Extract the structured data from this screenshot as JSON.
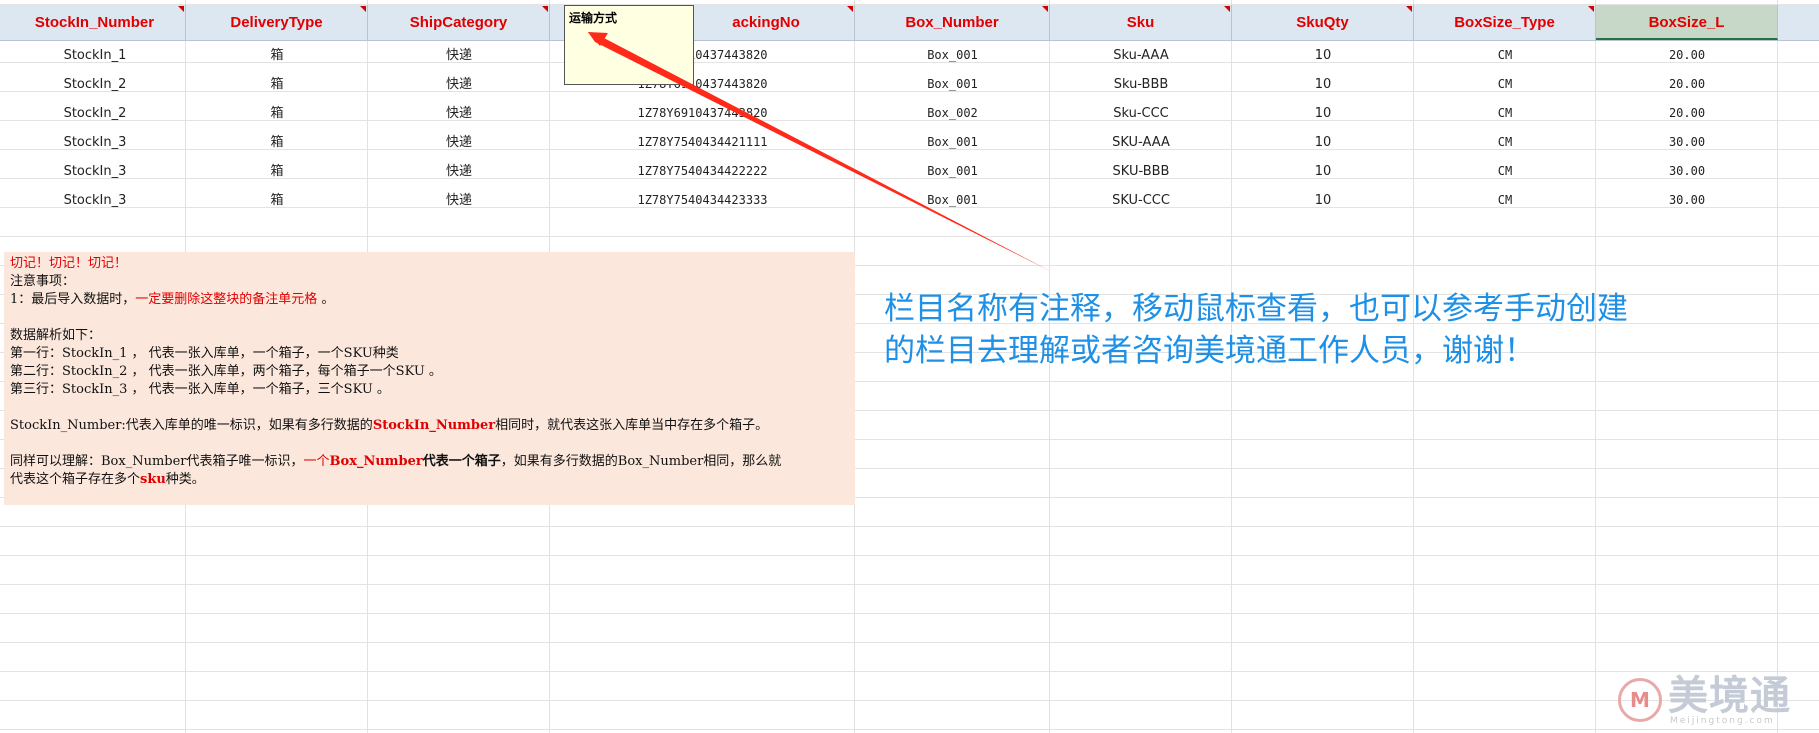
{
  "columns": [
    "StockIn_Number",
    "DeliveryType",
    "ShipCategory",
    "TrackingNo",
    "Box_Number",
    "Sku",
    "SkuQty",
    "BoxSize_Type",
    "BoxSize_L"
  ],
  "column_header_visible": {
    "trackingno": "ackingNo"
  },
  "rows": [
    {
      "stockin": "StockIn_1",
      "delivery": "箱",
      "ship": "快递",
      "tracking": "1Z78Y6910437443820",
      "box": "Box_001",
      "sku": "Sku-AAA",
      "qty": "10",
      "size_type": "CM",
      "size_l": "20.00"
    },
    {
      "stockin": "StockIn_2",
      "delivery": "箱",
      "ship": "快递",
      "tracking": "1Z78Y6910437443820",
      "box": "Box_001",
      "sku": "Sku-BBB",
      "qty": "10",
      "size_type": "CM",
      "size_l": "20.00"
    },
    {
      "stockin": "StockIn_2",
      "delivery": "箱",
      "ship": "快递",
      "tracking": "1Z78Y6910437443820",
      "box": "Box_002",
      "sku": "Sku-CCC",
      "qty": "10",
      "size_type": "CM",
      "size_l": "20.00"
    },
    {
      "stockin": "StockIn_3",
      "delivery": "箱",
      "ship": "快递",
      "tracking": "1Z78Y7540434421111",
      "box": "Box_001",
      "sku": "SKU-AAA",
      "qty": "10",
      "size_type": "CM",
      "size_l": "30.00"
    },
    {
      "stockin": "StockIn_3",
      "delivery": "箱",
      "ship": "快递",
      "tracking": "1Z78Y7540434422222",
      "box": "Box_001",
      "sku": "SKU-BBB",
      "qty": "10",
      "size_type": "CM",
      "size_l": "30.00"
    },
    {
      "stockin": "StockIn_3",
      "delivery": "箱",
      "ship": "快递",
      "tracking": "1Z78Y7540434423333",
      "box": "Box_001",
      "sku": "SKU-CCC",
      "qty": "10",
      "size_type": "CM",
      "size_l": "30.00"
    }
  ],
  "comment": {
    "text": "运输方式"
  },
  "notes": {
    "warning": "切记！切记！切记！",
    "heading": "注意事项：",
    "point1_prefix": "1：最后导入数据时，",
    "point1_red": "一定要删除这整块的备注单元格",
    "point1_suffix": " 。",
    "explain_heading": "数据解析如下：",
    "line1": "第一行：StockIn_1 ， 代表一张入库单，一个箱子，一个SKU种类",
    "line2": "第二行：StockIn_2 ，  代表一张入库单，两个箱子，每个箱子一个SKU  。",
    "line3": "第三行：StockIn_3 ， 代表一张入库单，一个箱子，三个SKU  。",
    "p1_prefix": "StockIn_Number:代表入库单的唯一标识，如果有多行数据的",
    "p1_bold": "StockIn_Number",
    "p1_suffix": "相同时，就代表这张入库单当中存在多个箱子。",
    "p2_prefix": "同样可以理解：Box_Number代表箱子唯一标识，",
    "p2_red": "一个",
    "p2_redbold": "Box_Number",
    "p2_bold": "代表一个箱子",
    "p2_suffix": "，如果有多行数据的Box_Number相同，那么就",
    "p3_prefix": "代表这个箱子存在多个",
    "p3_redbold": "sku",
    "p3_suffix": "种类。"
  },
  "annotation": {
    "line1": "栏目名称有注释，移动鼠标查看，也可以参考手动创建",
    "line2": "的栏目去理解或者咨询美境通工作人员，谢谢！"
  },
  "logo": {
    "mark": "M",
    "name": "美境通",
    "sub": "Meijingtong.com"
  },
  "colors": {
    "header_text": "#e00000",
    "annotation": "#1e90e6",
    "note_bg": "#fbe7dc",
    "comment_bg": "#ffffe1",
    "arrow": "#ff2a1a"
  }
}
